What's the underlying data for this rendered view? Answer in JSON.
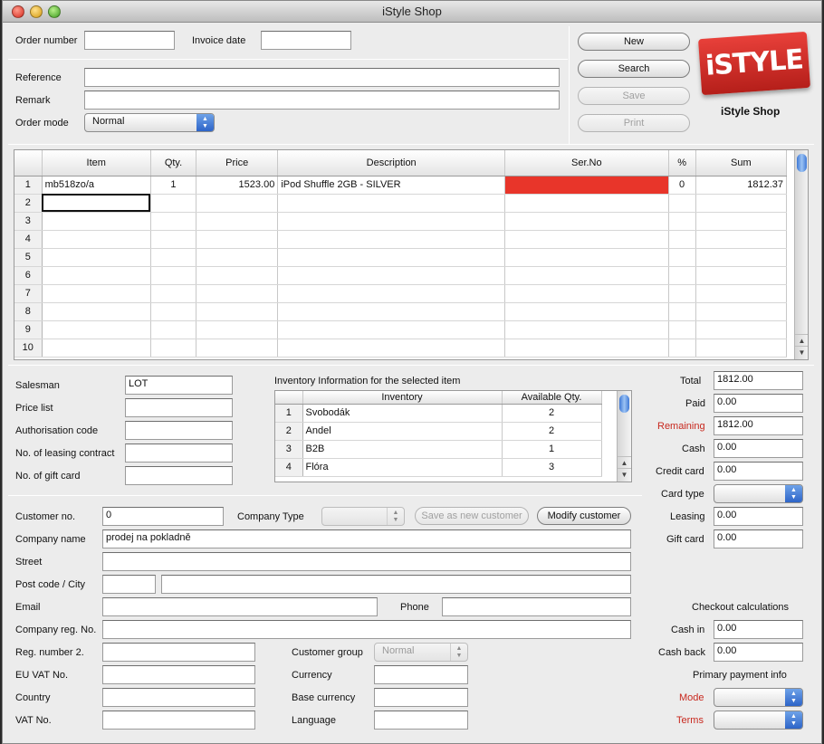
{
  "window": {
    "title": "iStyle Shop"
  },
  "order": {
    "order_number_label": "Order number",
    "order_number": "",
    "invoice_date_label": "Invoice date",
    "invoice_date": "",
    "reference_label": "Reference",
    "reference": "",
    "remark_label": "Remark",
    "remark": "",
    "order_mode_label": "Order mode",
    "order_mode": "Normal"
  },
  "actions": {
    "new": "New",
    "search": "Search",
    "save": "Save",
    "print": "Print"
  },
  "brand": {
    "logo_text": "iSTYLE",
    "caption": "iStyle Shop",
    "logo_color": "#d0302a"
  },
  "items_table": {
    "headers": [
      "Item",
      "Qty.",
      "Price",
      "Description",
      "Ser.No",
      "%",
      "Sum"
    ],
    "rows": [
      {
        "n": "1",
        "item": "mb518zo/a",
        "qty": "1",
        "price": "1523.00",
        "desc": "iPod Shuffle 2GB - SILVER",
        "serno": "",
        "pct": "0",
        "sum": "1812.37"
      },
      {
        "n": "2",
        "item": "",
        "qty": "",
        "price": "",
        "desc": "",
        "serno": "",
        "pct": "",
        "sum": ""
      },
      {
        "n": "3",
        "item": "",
        "qty": "",
        "price": "",
        "desc": "",
        "serno": "",
        "pct": "",
        "sum": ""
      },
      {
        "n": "4",
        "item": "",
        "qty": "",
        "price": "",
        "desc": "",
        "serno": "",
        "pct": "",
        "sum": ""
      },
      {
        "n": "5",
        "item": "",
        "qty": "",
        "price": "",
        "desc": "",
        "serno": "",
        "pct": "",
        "sum": ""
      },
      {
        "n": "6",
        "item": "",
        "qty": "",
        "price": "",
        "desc": "",
        "serno": "",
        "pct": "",
        "sum": ""
      },
      {
        "n": "7",
        "item": "",
        "qty": "",
        "price": "",
        "desc": "",
        "serno": "",
        "pct": "",
        "sum": ""
      },
      {
        "n": "8",
        "item": "",
        "qty": "",
        "price": "",
        "desc": "",
        "serno": "",
        "pct": "",
        "sum": ""
      },
      {
        "n": "9",
        "item": "",
        "qty": "",
        "price": "",
        "desc": "",
        "serno": "",
        "pct": "",
        "sum": ""
      },
      {
        "n": "10",
        "item": "",
        "qty": "",
        "price": "",
        "desc": "",
        "serno": "",
        "pct": "",
        "sum": ""
      }
    ],
    "serno_alert_color": "#e8352a"
  },
  "sales": {
    "salesman_label": "Salesman",
    "salesman": "LOT",
    "price_list_label": "Price list",
    "price_list": "",
    "auth_code_label": "Authorisation code",
    "auth_code": "",
    "leasing_contract_label": "No. of leasing contract",
    "leasing_contract": "",
    "gift_card_label": "No. of gift card",
    "gift_card": ""
  },
  "inventory": {
    "title": "Inventory Information for the selected item",
    "headers": [
      "Inventory",
      "Available Qty."
    ],
    "rows": [
      {
        "n": "1",
        "name": "Svobodák",
        "qty": "2"
      },
      {
        "n": "2",
        "name": "Andel",
        "qty": "2"
      },
      {
        "n": "3",
        "name": "B2B",
        "qty": "1"
      },
      {
        "n": "4",
        "name": "Flóra",
        "qty": "3"
      }
    ]
  },
  "payment": {
    "total_label": "Total",
    "total": "1812.00",
    "paid_label": "Paid",
    "paid": "0.00",
    "remaining_label": "Remaining",
    "remaining": "1812.00",
    "cash_label": "Cash",
    "cash": "0.00",
    "credit_card_label": "Credit card",
    "credit_card": "0.00",
    "card_type_label": "Card type",
    "card_type": "",
    "leasing_label": "Leasing",
    "leasing": "0.00",
    "gift_card_label": "Gift card",
    "gift_card": "0.00",
    "checkout_title": "Checkout calculations",
    "cash_in_label": "Cash in",
    "cash_in": "0.00",
    "cash_back_label": "Cash back",
    "cash_back": "0.00",
    "primary_title": "Primary payment info",
    "mode_label": "Mode",
    "mode": "",
    "terms_label": "Terms",
    "terms": "",
    "highlight_color": "#c8281e"
  },
  "customer": {
    "customer_no_label": "Customer no.",
    "customer_no": "0",
    "company_type_label": "Company Type",
    "company_type": "",
    "save_new_button": "Save as new customer",
    "modify_button": "Modify customer",
    "company_name_label": "Company name",
    "company_name": "prodej na pokladně",
    "street_label": "Street",
    "street": "",
    "post_city_label": "Post code / City",
    "post_code": "",
    "city": "",
    "email_label": "Email",
    "email": "",
    "phone_label": "Phone",
    "phone": "",
    "company_reg_label": "Company reg. No.",
    "company_reg": "",
    "reg_number2_label": "Reg. number 2.",
    "reg_number2": "",
    "customer_group_label": "Customer group",
    "customer_group": "Normal",
    "eu_vat_label": "EU VAT No.",
    "eu_vat": "",
    "currency_label": "Currency",
    "currency": "",
    "country_label": "Country",
    "country": "",
    "base_currency_label": "Base currency",
    "base_currency": "",
    "vat_label": "VAT No.",
    "vat": "",
    "language_label": "Language",
    "language": ""
  }
}
